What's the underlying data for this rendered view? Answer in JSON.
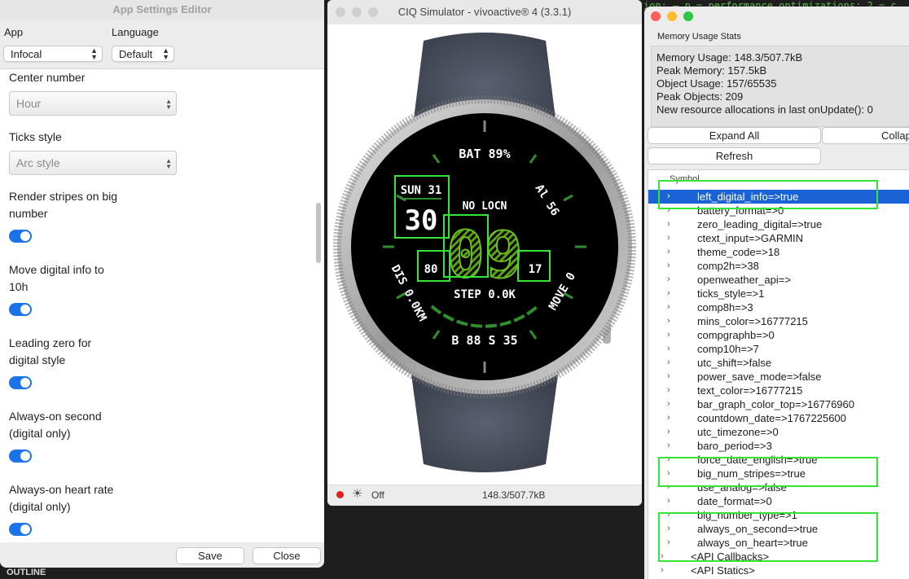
{
  "background": {
    "code_snippet": "ion:  — p = performance optimizations; 2 = c",
    "outline_label": "OUTLINE"
  },
  "settings_editor": {
    "title": "App Settings Editor",
    "app_label": "App",
    "language_label": "Language",
    "app_value": "Infocal",
    "language_value": "Default",
    "settings": [
      {
        "label": "Center number",
        "value": "Hour"
      },
      {
        "label": "Ticks style",
        "value": "Arc style"
      },
      {
        "label_line1": "Render stripes on big",
        "label_line2": "number",
        "enabled": true
      },
      {
        "label_line1": "Move digital info to",
        "label_line2": "10h",
        "enabled": true
      },
      {
        "label_line1": "Leading zero for",
        "label_line2": "digital style",
        "enabled": true
      },
      {
        "label_line1": "Always-on second",
        "label_line2": "(digital only)",
        "enabled": true
      },
      {
        "label_line1": "Always-on heart rate",
        "label_line2": "(digital only)",
        "enabled": true
      }
    ],
    "save_label": "Save",
    "close_label": "Close"
  },
  "simulator": {
    "title": "CIQ Simulator - vívoactive® 4 (3.3.1)",
    "watch_face": {
      "battery": "BAT 89%",
      "altitude": "Al 56",
      "date": "SUN 31",
      "day_number": "30",
      "location": "NO LOCN",
      "big_hour": "09",
      "left_small": "80",
      "right_small": "17",
      "steps": "STEP 0.0K",
      "distance": "DIS 0.0KM",
      "move": "MOVE 0",
      "bottom": "B 88 S 35"
    },
    "backlight_label": "Off",
    "memory_readout": "148.3/507.7kB"
  },
  "memory_stats": {
    "title": "Memory Usage Stats",
    "lines": [
      "Memory Usage: 148.3/507.7kB",
      "Peak Memory: 157.5kB",
      "Object Usage: 157/65535",
      "Peak Objects: 209",
      "New resource allocations in last onUpdate(): 0"
    ],
    "expand_all_label": "Expand All",
    "collapse_label": "Collap",
    "refresh_label": "Refresh",
    "column_header": "Symbol",
    "symbols": [
      "left_digital_info=>true",
      "battery_format=>0",
      "zero_leading_digital=>true",
      "ctext_input=>GARMIN",
      "theme_code=>18",
      "comp2h=>38",
      "openweather_api=>",
      "ticks_style=>1",
      "comp8h=>3",
      "mins_color=>16777215",
      "compgraphb=>0",
      "comp10h=>7",
      "utc_shift=>false",
      "power_save_mode=>false",
      "text_color=>16777215",
      "bar_graph_color_top=>16776960",
      "countdown_date=>1767225600",
      "utc_timezone=>0",
      "baro_period=>3",
      "force_date_english=>true",
      "big_num_stripes=>true",
      "use_analog=>false",
      "date_format=>0",
      "big_number_type=>1",
      "always_on_second=>true",
      "always_on_heart=>true"
    ],
    "api_callbacks": "<API Callbacks>",
    "api_statics": "<API Statics>"
  }
}
